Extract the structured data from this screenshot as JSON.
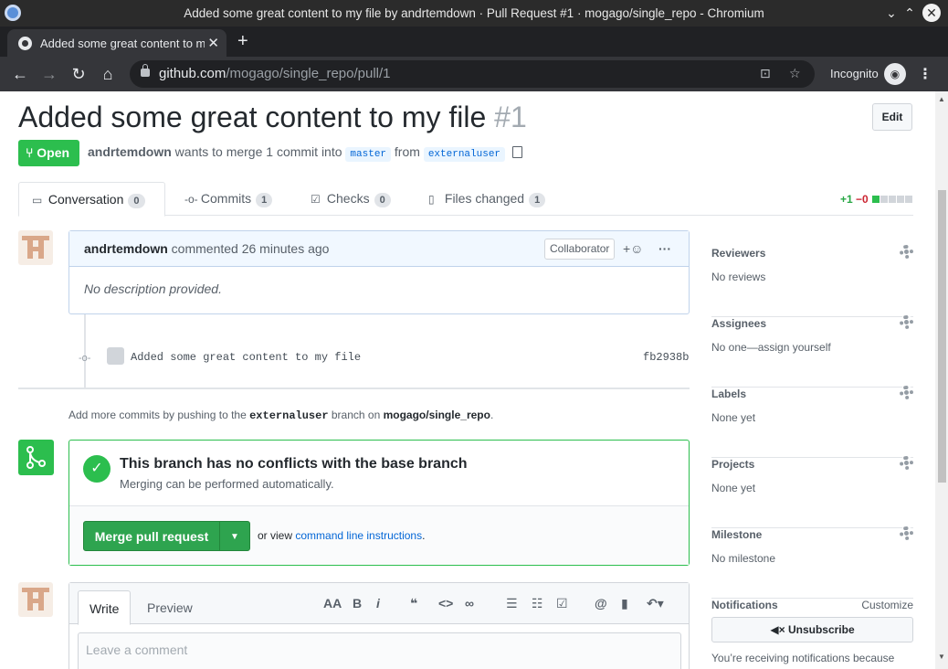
{
  "window": {
    "title": "Added some great content to my file by andrtemdown · Pull Request #1 · mogago/single_repo - Chromium"
  },
  "browser": {
    "tab_title": "Added some great content to my file",
    "url_host": "github.com",
    "url_path": "/mogago/single_repo/pull/1",
    "incognito_label": "Incognito"
  },
  "pr": {
    "title": "Added some great content to my file",
    "number": "#1",
    "edit_label": "Edit",
    "state": "Open",
    "author": "andrtemdown",
    "merge_text_1": "wants to merge 1 commit into",
    "base_branch": "master",
    "merge_text_2": "from",
    "head_branch": "externaluser"
  },
  "tabs": [
    {
      "label": "Conversation",
      "count": "0"
    },
    {
      "label": "Commits",
      "count": "1"
    },
    {
      "label": "Checks",
      "count": "0"
    },
    {
      "label": "Files changed",
      "count": "1"
    }
  ],
  "diffstat": {
    "added": "+1",
    "removed": "−0"
  },
  "comment": {
    "author": "andrtemdown",
    "action": "commented 26 minutes ago",
    "role": "Collaborator",
    "body": "No description provided."
  },
  "commit": {
    "message": "Added some great content to my file",
    "sha": "fb2938b"
  },
  "push_note": {
    "prefix": "Add more commits by pushing to the",
    "branch": "externaluser",
    "middle": "branch on",
    "repo": "mogago/single_repo",
    "suffix": "."
  },
  "merge": {
    "title": "This branch has no conflicts with the base branch",
    "subtitle": "Merging can be performed automatically.",
    "button": "Merge pull request",
    "alt_prefix": "or view",
    "alt_link": "command line instructions",
    "alt_suffix": "."
  },
  "composer": {
    "write_tab": "Write",
    "preview_tab": "Preview",
    "placeholder": "Leave a comment"
  },
  "sidebar": {
    "reviewers": {
      "title": "Reviewers",
      "value": "No reviews"
    },
    "assignees": {
      "title": "Assignees",
      "value": "No one—assign yourself"
    },
    "labels": {
      "title": "Labels",
      "value": "None yet"
    },
    "projects": {
      "title": "Projects",
      "value": "None yet"
    },
    "milestone": {
      "title": "Milestone",
      "value": "No milestone"
    },
    "notifications": {
      "title": "Notifications",
      "customize": "Customize",
      "button": "Unsubscribe",
      "reason": "You’re receiving notifications because"
    }
  }
}
